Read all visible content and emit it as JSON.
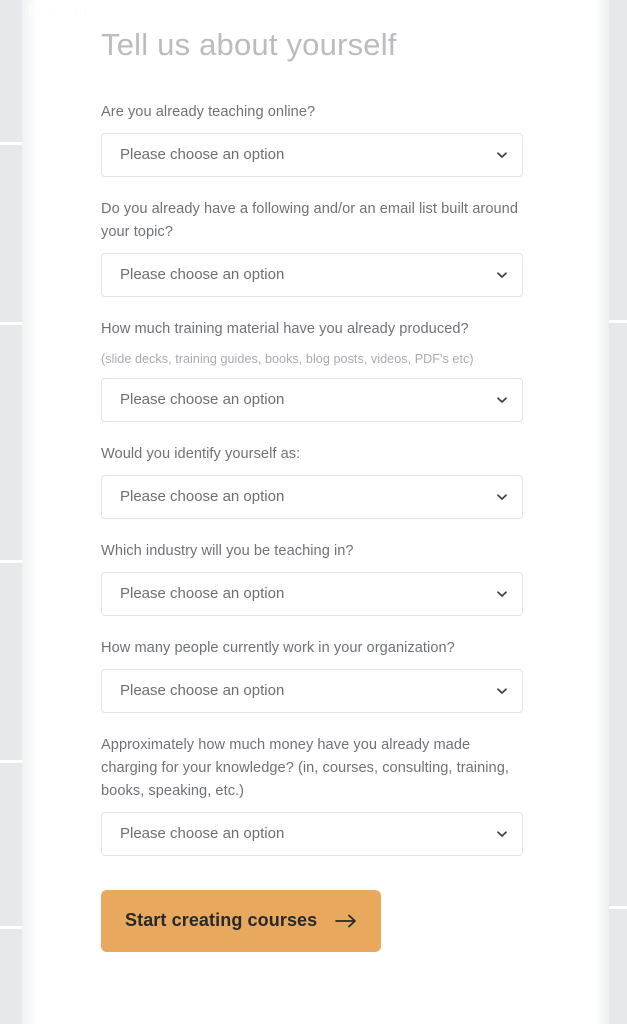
{
  "page": {
    "title": "Tell us about yourself",
    "ghost_logo": "teachable",
    "background_color": "#ffffff",
    "title_color": "#bcbcc0"
  },
  "form": {
    "placeholder_option": "Please choose an option",
    "select_icon": "chevron-down-icon",
    "questions": [
      {
        "label": "Are you already teaching online?",
        "hint": "",
        "value": "Please choose an option"
      },
      {
        "label": "Do you already have a following and/or an email list built around your topic?",
        "hint": "",
        "value": "Please choose an option"
      },
      {
        "label": "How much training material have you already produced?",
        "hint": "(slide decks, training guides, books, blog posts, videos, PDF's etc)",
        "value": "Please choose an option"
      },
      {
        "label": "Would you identify yourself as:",
        "hint": "",
        "value": "Please choose an option"
      },
      {
        "label": "Which industry will you be teaching in?",
        "hint": "",
        "value": "Please choose an option"
      },
      {
        "label": "How many people currently work in your organization?",
        "hint": "",
        "value": "Please choose an option"
      },
      {
        "label": "Approximately how much money have you already made charging for your knowledge? (in, courses, consulting, training, books, speaking, etc.)",
        "hint": "",
        "value": "Please choose an option"
      }
    ]
  },
  "submit": {
    "label": "Start creating courses",
    "icon": "arrow-right-icon",
    "background_color": "#e8a95e",
    "text_color": "#27292c"
  }
}
